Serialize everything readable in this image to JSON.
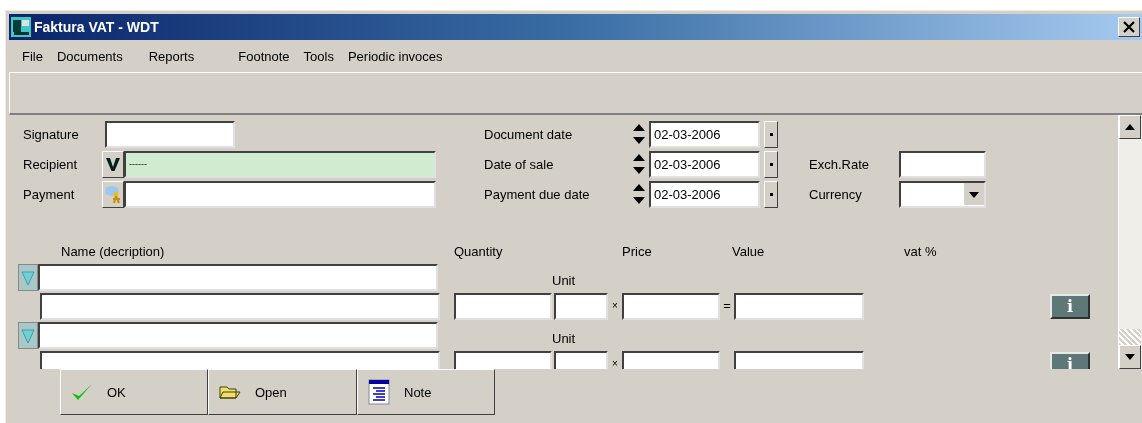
{
  "window": {
    "title": "Faktura VAT - WDT"
  },
  "menu": [
    {
      "label": "File"
    },
    {
      "label": "Documents"
    },
    {
      "label": "Reports"
    },
    {
      "label": "Footnote"
    },
    {
      "label": "Tools"
    },
    {
      "label": "Periodic invoces"
    }
  ],
  "header": {
    "signature": {
      "label": "Signature"
    },
    "recipient": {
      "label": "Recipient",
      "value": "------"
    },
    "payment": {
      "label": "Payment"
    }
  },
  "dates": [
    {
      "label": "Document date",
      "value": "02-03-2006"
    },
    {
      "label": "Date of sale",
      "value": "02-03-2006"
    },
    {
      "label": "Payment due date",
      "value": "02-03-2006"
    }
  ],
  "exchange_rate": {
    "label": "Exch.Rate"
  },
  "currency": {
    "label": "Currency"
  },
  "columns": [
    {
      "label": "Name  (decription)"
    },
    {
      "label": "Quantity"
    },
    {
      "label": "Price"
    },
    {
      "label": "Value"
    },
    {
      "label": "vat %"
    }
  ],
  "items": [
    {
      "unit_label": "Unit",
      "times": "×",
      "equals": "=",
      "info_label": "i"
    },
    {
      "unit_label": "Unit",
      "times": "×",
      "info_label": "i"
    }
  ],
  "buttons": [
    {
      "kind": "ok",
      "label": "OK"
    },
    {
      "kind": "open",
      "label": "Open"
    },
    {
      "kind": "note",
      "label": "Note"
    }
  ]
}
